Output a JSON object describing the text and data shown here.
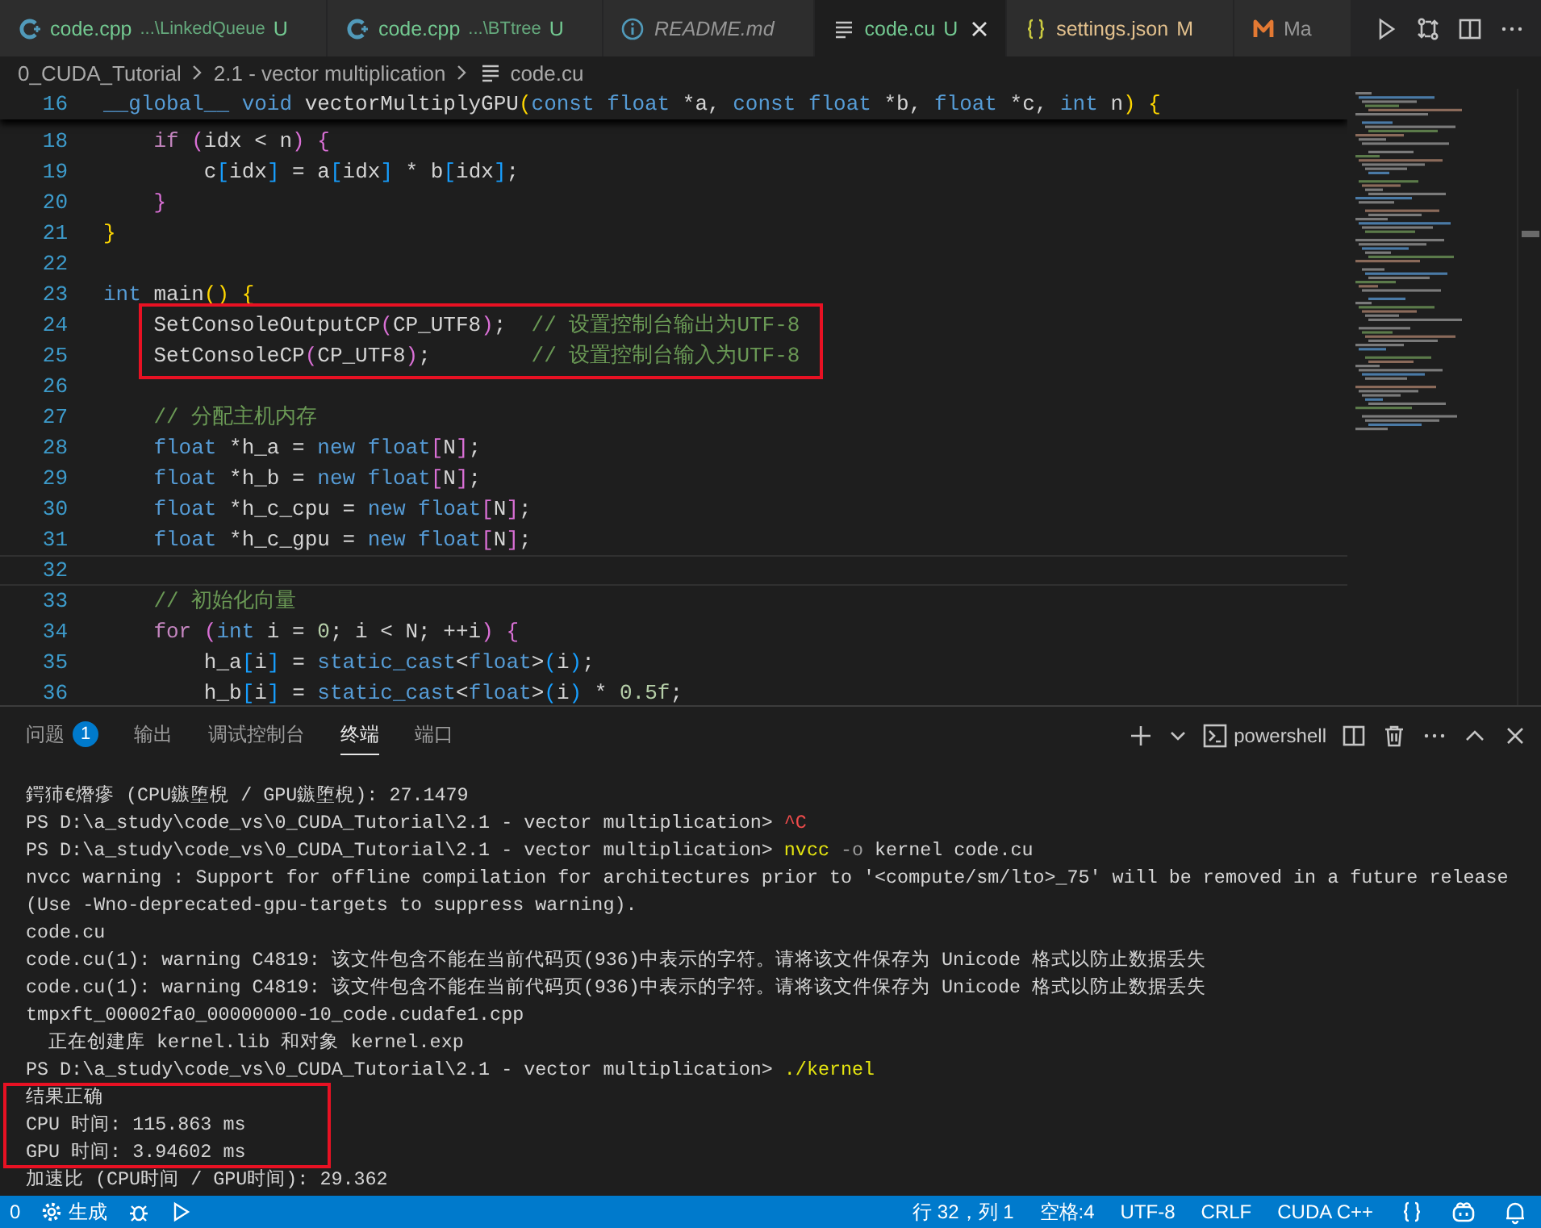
{
  "tabs": [
    {
      "kind": "cpp",
      "label": "code.cpp",
      "path": "...\\LinkedQueue",
      "status": "U",
      "color": "#73c991",
      "preview": false,
      "selected": false
    },
    {
      "kind": "cpp",
      "label": "code.cpp",
      "path": "...\\BTtree",
      "status": "U",
      "color": "#73c991",
      "preview": false,
      "selected": false
    },
    {
      "kind": "info",
      "label": "README.md",
      "preview": true,
      "selected": false
    },
    {
      "kind": "text",
      "label": "code.cu",
      "status": "U",
      "color": "#73c991",
      "preview": false,
      "selected": true
    },
    {
      "kind": "json",
      "label": "settings.json",
      "status": "M",
      "color": "#e2c08d",
      "preview": false,
      "selected": false
    },
    {
      "kind": "markdown",
      "label": "Ma",
      "preview": false,
      "selected": false
    }
  ],
  "editor_actions": [
    {
      "kind": "run"
    },
    {
      "kind": "compare"
    },
    {
      "kind": "split"
    },
    {
      "kind": "more"
    }
  ],
  "breadcrumb": [
    {
      "kind": "folder",
      "text": "0_CUDA_Tutorial"
    },
    {
      "kind": "folder",
      "text": "2.1 - vector multiplication"
    },
    {
      "kind": "file",
      "text": "code.cu"
    }
  ],
  "editor": {
    "sticky": {
      "number": "16",
      "tokens": [
        {
          "text": "__global__",
          "kind": "kw"
        },
        {
          "text": " void",
          "kind": "kw"
        },
        {
          "text": " vectorMultiplyGPU",
          "kind": "plain"
        },
        {
          "text": "(",
          "kind": "b1"
        },
        {
          "text": "const",
          "kind": "kw"
        },
        {
          "text": " float",
          "kind": "kw"
        },
        {
          "text": " *a, ",
          "kind": "plain"
        },
        {
          "text": "const",
          "kind": "kw"
        },
        {
          "text": " float",
          "kind": "kw"
        },
        {
          "text": " *b, ",
          "kind": "plain"
        },
        {
          "text": "float",
          "kind": "kw"
        },
        {
          "text": " *c, ",
          "kind": "plain"
        },
        {
          "text": "int",
          "kind": "kw"
        },
        {
          "text": " n",
          "kind": "plain"
        },
        {
          "text": ")",
          "kind": "b1"
        },
        {
          "text": " {",
          "kind": "b1"
        }
      ]
    },
    "lines": [
      {
        "number": "18",
        "tokens": [
          {
            "text": "    if",
            "kind": "ctrl"
          },
          {
            "text": " (",
            "kind": "b2"
          },
          {
            "text": "idx < n",
            "kind": "plain"
          },
          {
            "text": ")",
            "kind": "b2"
          },
          {
            "text": " {",
            "kind": "b2"
          }
        ]
      },
      {
        "number": "19",
        "tokens": [
          {
            "text": "        c",
            "kind": "plain"
          },
          {
            "text": "[",
            "kind": "b3"
          },
          {
            "text": "idx",
            "kind": "plain"
          },
          {
            "text": "]",
            "kind": "b3"
          },
          {
            "text": " = a",
            "kind": "plain"
          },
          {
            "text": "[",
            "kind": "b3"
          },
          {
            "text": "idx",
            "kind": "plain"
          },
          {
            "text": "]",
            "kind": "b3"
          },
          {
            "text": " * b",
            "kind": "plain"
          },
          {
            "text": "[",
            "kind": "b3"
          },
          {
            "text": "idx",
            "kind": "plain"
          },
          {
            "text": "]",
            "kind": "b3"
          },
          {
            "text": ";",
            "kind": "plain"
          }
        ]
      },
      {
        "number": "20",
        "tokens": [
          {
            "text": "    }",
            "kind": "b2"
          }
        ]
      },
      {
        "number": "21",
        "tokens": [
          {
            "text": "}",
            "kind": "b1"
          }
        ]
      },
      {
        "number": "22"
      },
      {
        "number": "23",
        "tokens": [
          {
            "text": "int",
            "kind": "kw"
          },
          {
            "text": " main",
            "kind": "plain"
          },
          {
            "text": "()",
            "kind": "b1"
          },
          {
            "text": " {",
            "kind": "b1"
          }
        ]
      },
      {
        "number": "24",
        "boxed": true,
        "tokens": [
          {
            "text": "    SetConsoleOutputCP",
            "kind": "plain"
          },
          {
            "text": "(",
            "kind": "b2"
          },
          {
            "text": "CP_UTF8",
            "kind": "plain"
          },
          {
            "text": ")",
            "kind": "b2"
          },
          {
            "text": ";",
            "kind": "plain"
          },
          {
            "text": "  // 设置控制台输出为UTF-8",
            "kind": "com"
          }
        ]
      },
      {
        "number": "25",
        "boxed": true,
        "tokens": [
          {
            "text": "    SetConsoleCP",
            "kind": "plain"
          },
          {
            "text": "(",
            "kind": "b2"
          },
          {
            "text": "CP_UTF8",
            "kind": "plain"
          },
          {
            "text": ")",
            "kind": "b2"
          },
          {
            "text": ";",
            "kind": "plain"
          },
          {
            "text": "        // 设置控制台输入为UTF-8",
            "kind": "com"
          }
        ]
      },
      {
        "number": "26"
      },
      {
        "number": "27",
        "tokens": [
          {
            "text": "    // 分配主机内存",
            "kind": "com"
          }
        ]
      },
      {
        "number": "28",
        "tokens": [
          {
            "text": "    float",
            "kind": "kw"
          },
          {
            "text": " *h_a = ",
            "kind": "plain"
          },
          {
            "text": "new",
            "kind": "kw"
          },
          {
            "text": " float",
            "kind": "kw"
          },
          {
            "text": "[",
            "kind": "b2"
          },
          {
            "text": "N",
            "kind": "plain"
          },
          {
            "text": "]",
            "kind": "b2"
          },
          {
            "text": ";",
            "kind": "plain"
          }
        ]
      },
      {
        "number": "29",
        "tokens": [
          {
            "text": "    float",
            "kind": "kw"
          },
          {
            "text": " *h_b = ",
            "kind": "plain"
          },
          {
            "text": "new",
            "kind": "kw"
          },
          {
            "text": " float",
            "kind": "kw"
          },
          {
            "text": "[",
            "kind": "b2"
          },
          {
            "text": "N",
            "kind": "plain"
          },
          {
            "text": "]",
            "kind": "b2"
          },
          {
            "text": ";",
            "kind": "plain"
          }
        ]
      },
      {
        "number": "30",
        "tokens": [
          {
            "text": "    float",
            "kind": "kw"
          },
          {
            "text": " *h_c_cpu = ",
            "kind": "plain"
          },
          {
            "text": "new",
            "kind": "kw"
          },
          {
            "text": " float",
            "kind": "kw"
          },
          {
            "text": "[",
            "kind": "b2"
          },
          {
            "text": "N",
            "kind": "plain"
          },
          {
            "text": "]",
            "kind": "b2"
          },
          {
            "text": ";",
            "kind": "plain"
          }
        ]
      },
      {
        "number": "31",
        "tokens": [
          {
            "text": "    float",
            "kind": "kw"
          },
          {
            "text": " *h_c_gpu = ",
            "kind": "plain"
          },
          {
            "text": "new",
            "kind": "kw"
          },
          {
            "text": " float",
            "kind": "kw"
          },
          {
            "text": "[",
            "kind": "b2"
          },
          {
            "text": "N",
            "kind": "plain"
          },
          {
            "text": "]",
            "kind": "b2"
          },
          {
            "text": ";",
            "kind": "plain"
          }
        ]
      },
      {
        "number": "32",
        "current": true
      },
      {
        "number": "33",
        "tokens": [
          {
            "text": "    // 初始化向量",
            "kind": "com"
          }
        ]
      },
      {
        "number": "34",
        "tokens": [
          {
            "text": "    for",
            "kind": "ctrl"
          },
          {
            "text": " (",
            "kind": "b2"
          },
          {
            "text": "int",
            "kind": "kw"
          },
          {
            "text": " i = ",
            "kind": "plain"
          },
          {
            "text": "0",
            "kind": "num"
          },
          {
            "text": "; i < N; ++i",
            "kind": "plain"
          },
          {
            "text": ")",
            "kind": "b2"
          },
          {
            "text": " {",
            "kind": "b2"
          }
        ]
      },
      {
        "number": "35",
        "tokens": [
          {
            "text": "        h_a",
            "kind": "plain"
          },
          {
            "text": "[",
            "kind": "b3"
          },
          {
            "text": "i",
            "kind": "plain"
          },
          {
            "text": "]",
            "kind": "b3"
          },
          {
            "text": " = ",
            "kind": "plain"
          },
          {
            "text": "static_cast",
            "kind": "kw"
          },
          {
            "text": "<",
            "kind": "plain"
          },
          {
            "text": "float",
            "kind": "kw"
          },
          {
            "text": ">",
            "kind": "plain"
          },
          {
            "text": "(",
            "kind": "b3"
          },
          {
            "text": "i",
            "kind": "plain"
          },
          {
            "text": ")",
            "kind": "b3"
          },
          {
            "text": ";",
            "kind": "plain"
          }
        ]
      },
      {
        "number": "36",
        "tokens": [
          {
            "text": "        h_b",
            "kind": "plain"
          },
          {
            "text": "[",
            "kind": "b3"
          },
          {
            "text": "i",
            "kind": "plain"
          },
          {
            "text": "]",
            "kind": "b3"
          },
          {
            "text": " = ",
            "kind": "plain"
          },
          {
            "text": "static_cast",
            "kind": "kw"
          },
          {
            "text": "<",
            "kind": "plain"
          },
          {
            "text": "float",
            "kind": "kw"
          },
          {
            "text": ">",
            "kind": "plain"
          },
          {
            "text": "(",
            "kind": "b3"
          },
          {
            "text": "i",
            "kind": "plain"
          },
          {
            "text": ")",
            "kind": "b3"
          },
          {
            "text": " * ",
            "kind": "plain"
          },
          {
            "text": "0.5f",
            "kind": "num"
          },
          {
            "text": ";",
            "kind": "plain"
          }
        ]
      }
    ]
  },
  "panel": {
    "tabs": [
      {
        "label": "问题",
        "badge": "1",
        "selected": false
      },
      {
        "label": "输出",
        "selected": false
      },
      {
        "label": "调试控制台",
        "selected": false
      },
      {
        "label": "终端",
        "selected": true
      },
      {
        "label": "端口",
        "selected": false
      }
    ],
    "terminal_name": "powershell",
    "terminal": [
      {
        "tokens": [
          {
            "text": "鍔犻€熸瘮 (CPU鏃堕棿 / GPU鏃堕棿): 27.1479",
            "kind": "plain"
          }
        ]
      },
      {
        "tokens": [
          {
            "text": "PS D:\\a_study\\code_vs\\0_CUDA_Tutorial\\2.1 - vector multiplication>",
            "kind": "plain"
          },
          {
            "text": " ^C",
            "kind": "err"
          }
        ]
      },
      {
        "tokens": [
          {
            "text": "PS D:\\a_study\\code_vs\\0_CUDA_Tutorial\\2.1 - vector multiplication>",
            "kind": "plain"
          },
          {
            "text": " nvcc",
            "kind": "cmd"
          },
          {
            "text": " -o",
            "kind": "flag"
          },
          {
            "text": " kernel code.cu",
            "kind": "plain"
          }
        ]
      },
      {
        "tokens": [
          {
            "text": "nvcc warning : Support for offline compilation for architectures prior to '<compute/sm/lto>_75' will be removed in a future release",
            "kind": "plain"
          }
        ]
      },
      {
        "tokens": [
          {
            "text": "(Use -Wno-deprecated-gpu-targets to suppress warning).",
            "kind": "plain"
          }
        ]
      },
      {
        "tokens": [
          {
            "text": "code.cu",
            "kind": "plain"
          }
        ]
      },
      {
        "tokens": [
          {
            "text": "code.cu(1): warning C4819: 该文件包含不能在当前代码页(936)中表示的字符。请将该文件保存为 Unicode 格式以防止数据丢失",
            "kind": "plain"
          }
        ]
      },
      {
        "tokens": [
          {
            "text": "code.cu(1): warning C4819: 该文件包含不能在当前代码页(936)中表示的字符。请将该文件保存为 Unicode 格式以防止数据丢失",
            "kind": "plain"
          }
        ]
      },
      {
        "tokens": [
          {
            "text": "tmpxft_00002fa0_00000000-10_code.cudafe1.cpp",
            "kind": "plain"
          }
        ]
      },
      {
        "tokens": [
          {
            "text": "  正在创建库 kernel.lib 和对象 kernel.exp",
            "kind": "plain"
          }
        ]
      },
      {
        "tokens": [
          {
            "text": "PS D:\\a_study\\code_vs\\0_CUDA_Tutorial\\2.1 - vector multiplication>",
            "kind": "plain"
          },
          {
            "text": " ./kernel",
            "kind": "cmd"
          }
        ]
      },
      {
        "boxed": true,
        "tokens": [
          {
            "text": "结果正确",
            "kind": "plain"
          }
        ]
      },
      {
        "boxed": true,
        "tokens": [
          {
            "text": "CPU 时间: 115.863 ms",
            "kind": "plain"
          }
        ]
      },
      {
        "boxed": true,
        "tokens": [
          {
            "text": "GPU 时间: 3.94602 ms",
            "kind": "plain"
          }
        ]
      },
      {
        "tokens": [
          {
            "text": "加速比 (CPU时间 / GPU时间): 29.362",
            "kind": "plain"
          }
        ]
      }
    ]
  },
  "status_bar": {
    "left": [
      {
        "kind": "text",
        "text": "0"
      },
      {
        "kind": "gear",
        "text": "生成"
      },
      {
        "kind": "bug"
      },
      {
        "kind": "play"
      }
    ],
    "right": [
      {
        "kind": "text",
        "text": "行 32，列 1"
      },
      {
        "kind": "text",
        "text": "空格:4"
      },
      {
        "kind": "text",
        "text": "UTF-8"
      },
      {
        "kind": "text",
        "text": "CRLF"
      },
      {
        "kind": "text",
        "text": "CUDA C++"
      },
      {
        "kind": "braces"
      },
      {
        "kind": "copilot"
      },
      {
        "kind": "bell"
      }
    ]
  }
}
